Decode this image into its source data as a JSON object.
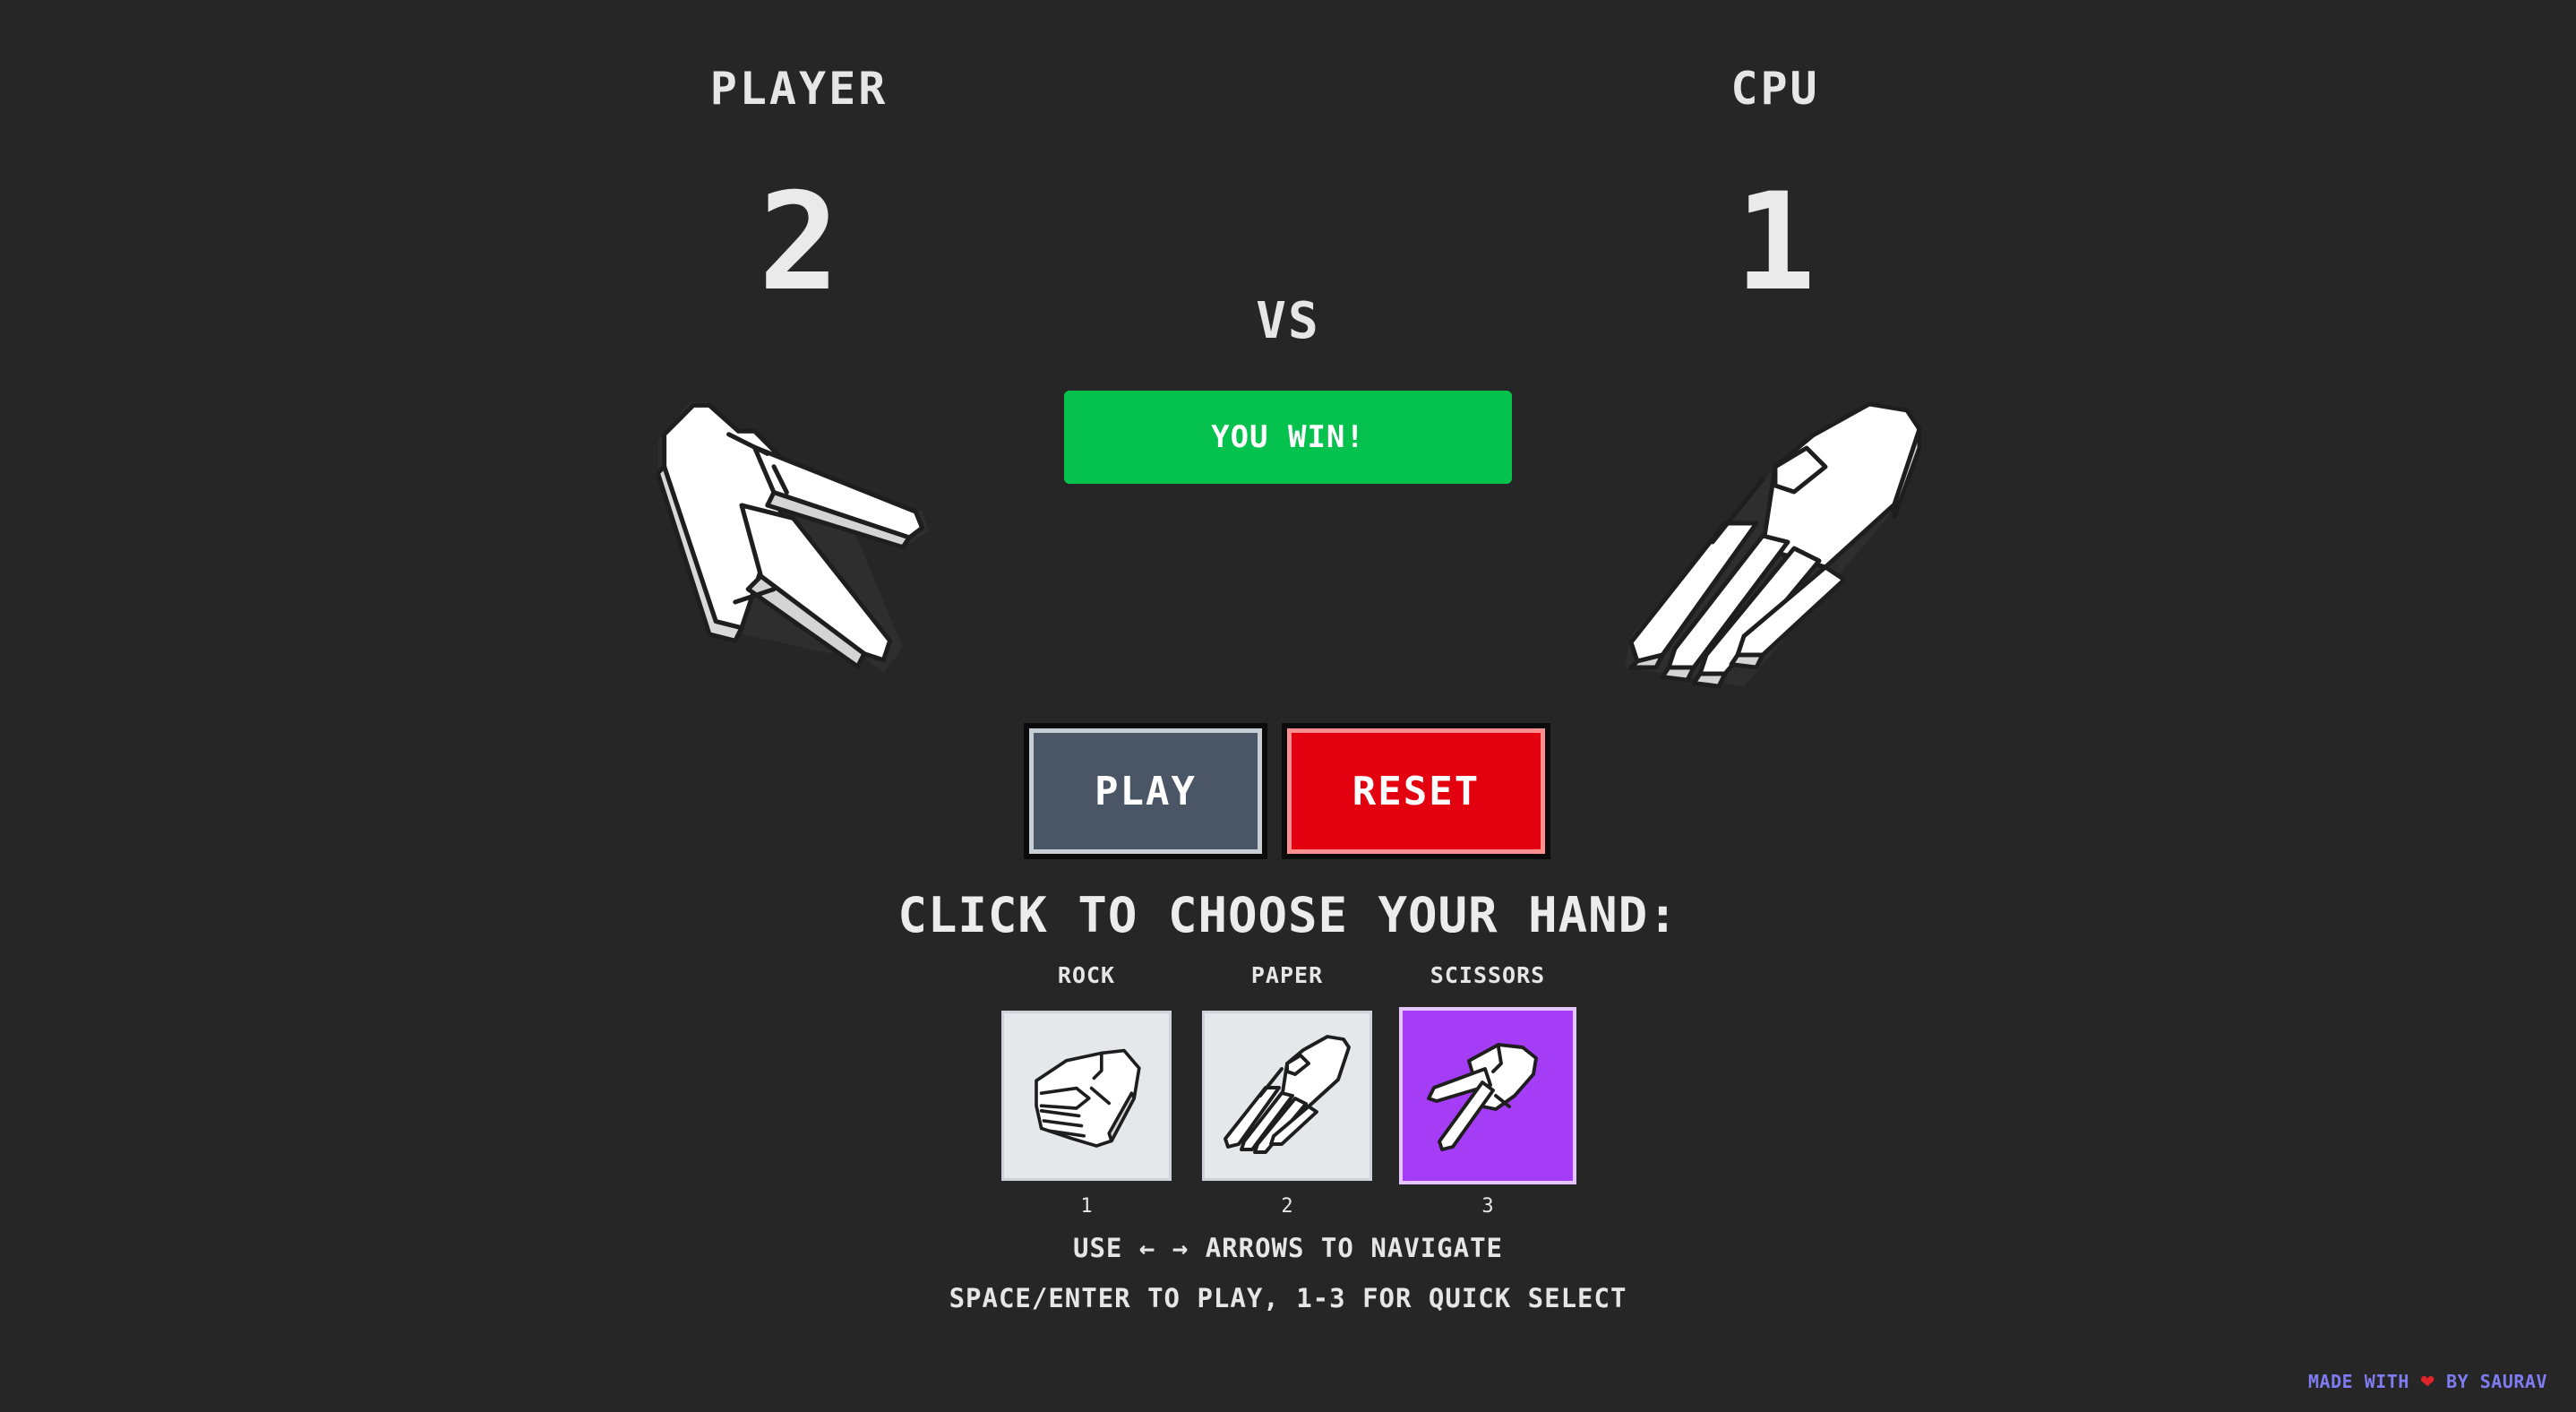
{
  "player": {
    "label": "PLAYER",
    "score": "2",
    "hand": "scissors"
  },
  "cpu": {
    "label": "CPU",
    "score": "1",
    "hand": "paper"
  },
  "vs_label": "VS",
  "result": {
    "text": "YOU WIN!",
    "color": "#05c14d"
  },
  "buttons": {
    "play": "PLAY",
    "reset": "RESET"
  },
  "chooser": {
    "title": "CLICK TO CHOOSE YOUR HAND:",
    "selected": "scissors",
    "options": [
      {
        "label": "ROCK",
        "key": "1",
        "icon": "rock-hand-icon"
      },
      {
        "label": "PAPER",
        "key": "2",
        "icon": "paper-hand-icon"
      },
      {
        "label": "SCISSORS",
        "key": "3",
        "icon": "scissors-hand-icon"
      }
    ]
  },
  "hints": {
    "line1_prefix": "USE",
    "arrows": "← →",
    "line1_suffix": "ARROWS TO NAVIGATE",
    "line2": "SPACE/ENTER TO PLAY, 1-3 FOR QUICK SELECT"
  },
  "footer": {
    "prefix": "MADE WITH",
    "heart": "❤",
    "suffix": "BY SAURAV"
  },
  "colors": {
    "background": "#262626",
    "play_button": "#4a5565",
    "reset_button": "#e3000f",
    "selected_card": "#a43df5",
    "footer_text": "#7e7cf0"
  }
}
